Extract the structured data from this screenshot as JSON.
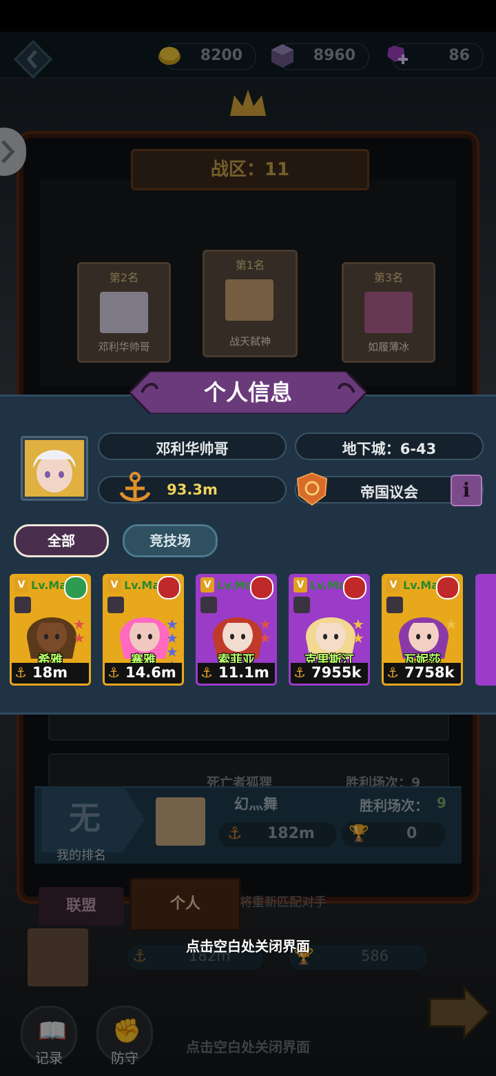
{
  "resources": {
    "gold": "8200",
    "crystal": "8960",
    "gem": "86"
  },
  "arena": {
    "zone_label": "战区：11",
    "ranks": [
      {
        "label": "第2名",
        "name": "邓利华帅哥"
      },
      {
        "label": "第1名",
        "name": "战天弑神"
      },
      {
        "label": "第3名",
        "name": "如履薄冰"
      }
    ],
    "partial_row": {
      "name": "死亡者狐狸",
      "wins": "胜利场次：9"
    },
    "my_rank": {
      "rank_value": "无",
      "rank_label": "我的排名",
      "opponent_name": "幻灬舞",
      "wins_label": "胜利场次：",
      "wins_value": "9",
      "power": "182m",
      "trophies": "0"
    },
    "tabs": {
      "alliance": "联盟",
      "personal": "个人"
    },
    "rematch_hint": "将重新匹配对手",
    "bottom_row": {
      "power": "182m",
      "trophies": "586"
    },
    "bottom_buttons": {
      "record": "记录",
      "defense": "防守"
    },
    "bottom_hint": "点击空白处关闭界面"
  },
  "panel": {
    "title": "个人信息",
    "player_name": "邓利华帅哥",
    "dungeon": "地下城：6-43",
    "power": "93.3m",
    "guild": "帝国议会",
    "filters": {
      "all": "全部",
      "arena": "竞技场"
    },
    "heroes": [
      {
        "level": "Lv.Max",
        "name": "希雅",
        "power": "18m",
        "element": "wind",
        "frame": "#e8a81c",
        "stars": "red2"
      },
      {
        "level": "Lv.Max",
        "name": "塞雅",
        "power": "14.6m",
        "element": "fire",
        "frame": "#e8a81c",
        "stars": "blue4"
      },
      {
        "level": "Lv.Max",
        "name": "索菲亚",
        "power": "11.1m",
        "element": "fire",
        "frame": "#9a3cc8",
        "stars": "red2"
      },
      {
        "level": "Lv.Max",
        "name": "克里斯汀",
        "power": "7955k",
        "element": "fire",
        "frame": "#9a3cc8",
        "stars": "gold2"
      },
      {
        "level": "Lv.Max",
        "name": "瓦妮莎",
        "power": "7758k",
        "element": "fire",
        "frame": "#e8a81c",
        "stars": "gold1"
      }
    ],
    "close_hint": "点击空白处关闭界面"
  },
  "colors": {
    "panel_bg": "#1f3344",
    "title_banner": "#6a3a7a",
    "hero_name": "#b8ff6a",
    "power_yellow": "#f0d35a"
  }
}
